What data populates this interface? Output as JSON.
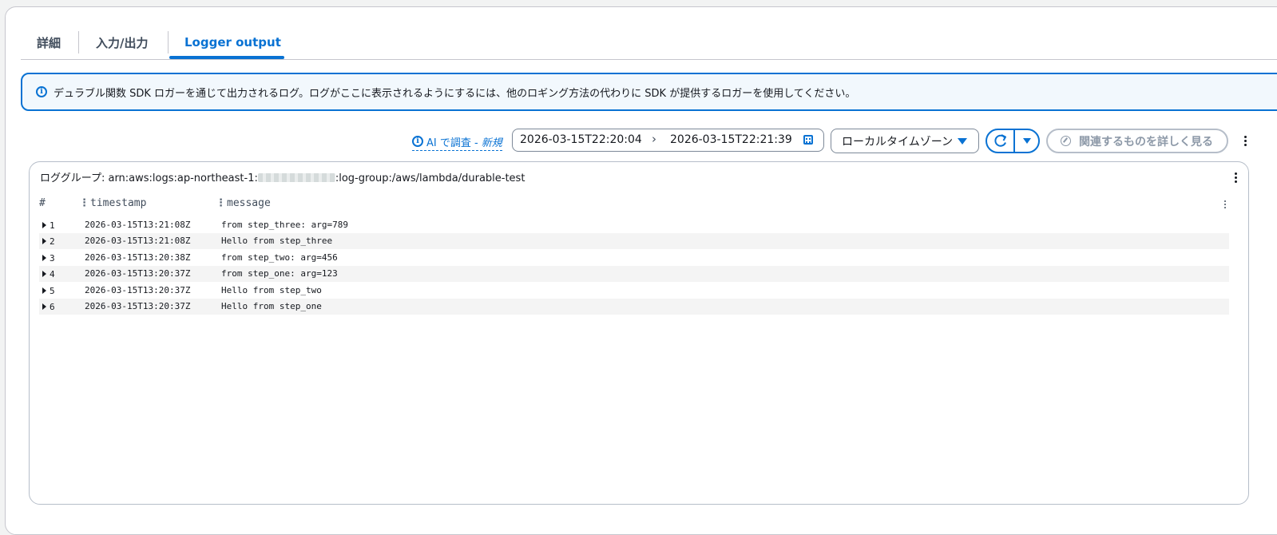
{
  "tabs": [
    {
      "label": "詳細",
      "active": false
    },
    {
      "label": "入力/出力",
      "active": false
    },
    {
      "label": "Logger output",
      "active": true
    }
  ],
  "alert": {
    "icon": "info-icon",
    "text": "デュラブル関数 SDK ロガーを通じて出力されるログ。ログがここに表示されるようにするには、他のロギング方法の代わりに SDK が提供するロガーを使用してください。"
  },
  "toolbar": {
    "ai_link_label": "AI で調査 -",
    "ai_link_new": "新規",
    "date_start": "2026-03-15T22:20:04",
    "date_arrow": "›",
    "date_end": "2026-03-15T22:21:39",
    "timezone": "ローカルタイムゾーン",
    "more_label": "関連するものを詳しく見る"
  },
  "log": {
    "group_prefix": "ロググループ: arn:aws:logs:ap-northeast-1:",
    "group_suffix": ":log-group:/aws/lambda/durable-test",
    "columns": {
      "hash": "#",
      "timestamp": "timestamp",
      "message": "message"
    },
    "rows": [
      {
        "index": "1",
        "timestamp": "2026-03-15T13:21:08Z",
        "message": "from step_three: arg=789"
      },
      {
        "index": "2",
        "timestamp": "2026-03-15T13:21:08Z",
        "message": "Hello from step_three"
      },
      {
        "index": "3",
        "timestamp": "2026-03-15T13:20:38Z",
        "message": "from step_two: arg=456"
      },
      {
        "index": "4",
        "timestamp": "2026-03-15T13:20:37Z",
        "message": "from step_one: arg=123"
      },
      {
        "index": "5",
        "timestamp": "2026-03-15T13:20:37Z",
        "message": "Hello from step_two"
      },
      {
        "index": "6",
        "timestamp": "2026-03-15T13:20:37Z",
        "message": "Hello from step_one"
      }
    ]
  },
  "colors": {
    "accent": "#0972d3",
    "alert_bg": "#f2f8fd",
    "disabled": "#8d99a8"
  }
}
